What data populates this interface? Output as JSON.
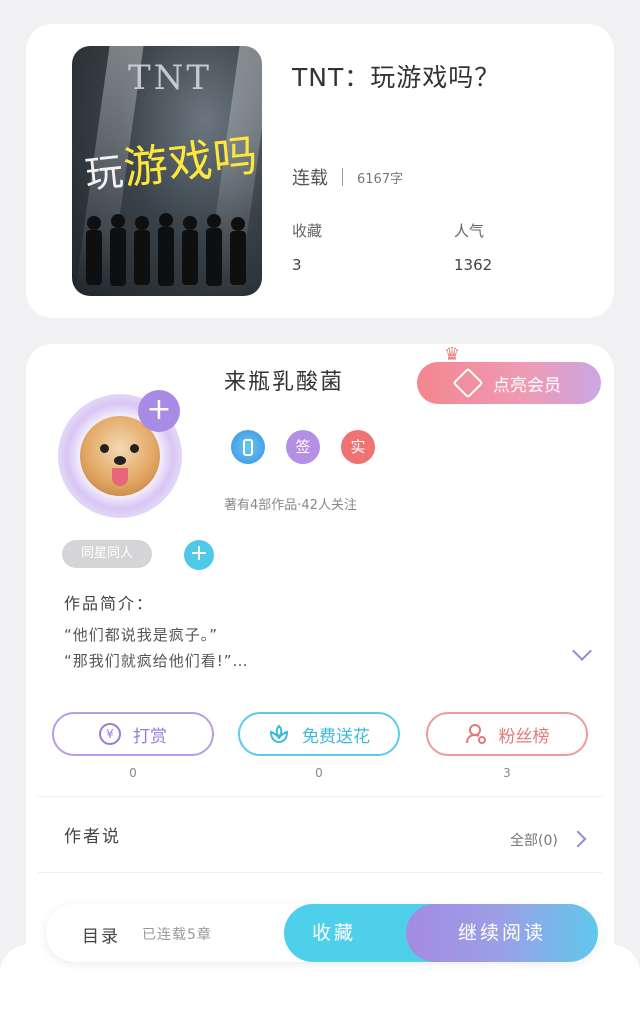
{
  "book": {
    "title": "TNT：玩游戏吗？",
    "cover": {
      "top_text": "TNT",
      "title_prefix": "玩",
      "title_highlight": "游戏吗"
    },
    "status": "连载",
    "word_count": "6167字",
    "stats": [
      {
        "label": "收藏",
        "value": "3"
      },
      {
        "label": "人气",
        "value": "1362"
      }
    ]
  },
  "author": {
    "name": "来瓶乳酸菌",
    "follow_icon": "plus-icon",
    "vip_button": "点亮会员",
    "badges": [
      {
        "name": "phone-verified-icon",
        "text": ""
      },
      {
        "name": "signed-badge",
        "text": "签"
      },
      {
        "name": "real-name-badge",
        "text": "实"
      }
    ],
    "stats_text": "著有4部作品·42人关注"
  },
  "tags": {
    "chip": "同星同人"
  },
  "intro": {
    "title": "作品简介：",
    "lines": [
      "“他们都说我是疯子。”",
      "“那我们就疯给他们看!”…"
    ]
  },
  "actions": [
    {
      "label": "打赏",
      "count": "0",
      "icon": "yen-icon"
    },
    {
      "label": "免费送花",
      "count": "0",
      "icon": "flower-icon"
    },
    {
      "label": "粉丝榜",
      "count": "3",
      "icon": "user-icon"
    }
  ],
  "author_say": {
    "title": "作者说",
    "all_link": "全部(0)"
  },
  "bottom_bar": {
    "toc": "目录",
    "chapters": "已连载5章",
    "collect": "收藏",
    "continue": "继续阅读"
  },
  "colors": {
    "purple": "#a78be4",
    "cyan": "#4fd0ea",
    "coral": "#ef7373"
  }
}
